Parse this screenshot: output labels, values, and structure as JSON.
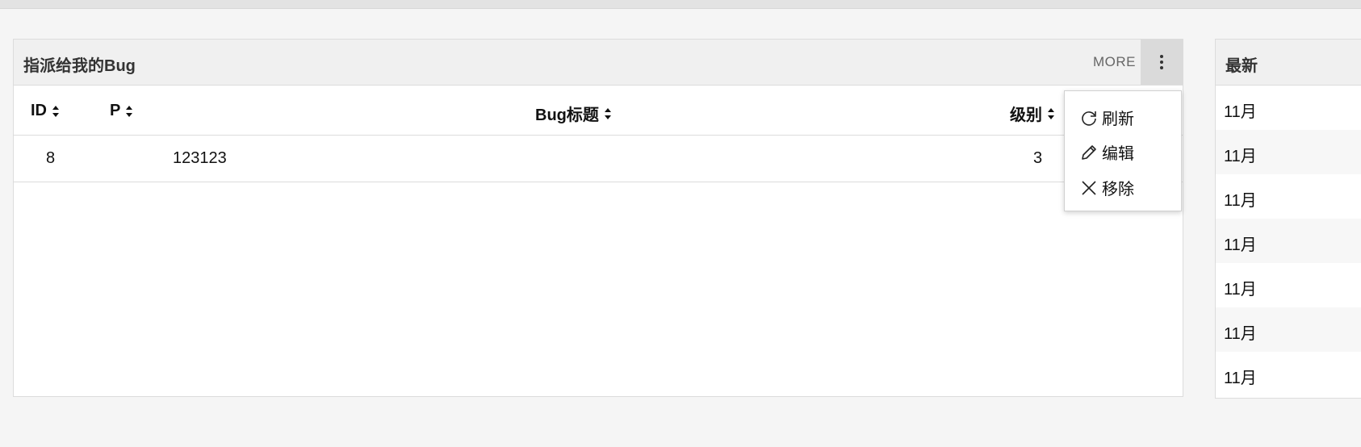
{
  "panel": {
    "title": "指派给我的Bug",
    "more_label": "MORE",
    "columns": [
      "ID",
      "P",
      "Bug标题",
      "级别"
    ],
    "rows": [
      {
        "id": "8",
        "p": "",
        "title": "123123",
        "level": "3"
      }
    ]
  },
  "menu": {
    "items": [
      {
        "label": "刷新",
        "icon": "refresh-icon"
      },
      {
        "label": "编辑",
        "icon": "pencil-icon"
      },
      {
        "label": "移除",
        "icon": "close-icon"
      }
    ]
  },
  "panel2": {
    "title": "最新",
    "rows": [
      "11月",
      "11月",
      "11月",
      "11月",
      "11月",
      "11月",
      "11月"
    ]
  }
}
